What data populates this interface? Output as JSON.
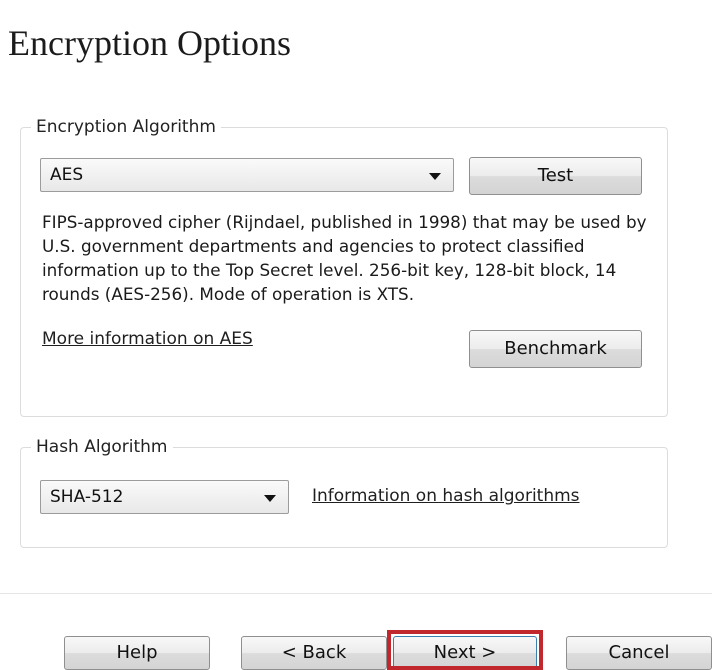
{
  "title": "Encryption Options",
  "encryption": {
    "legend": "Encryption Algorithm",
    "algorithm": "AES",
    "test_label": "Test",
    "description": "FIPS-approved cipher (Rijndael, published in 1998) that may be used by U.S. government departments and agencies to protect classified information up to the Top Secret level. 256-bit key, 128-bit block, 14 rounds (AES-256). Mode of operation is XTS.",
    "more_info_link": "More information on AES",
    "benchmark_label": "Benchmark"
  },
  "hash": {
    "legend": "Hash Algorithm",
    "algorithm": "SHA-512",
    "info_link": "Information on hash algorithms"
  },
  "buttons": {
    "help": "Help",
    "back": "< Back",
    "next": "Next >",
    "cancel": "Cancel"
  },
  "highlight_color": "#c0282e"
}
